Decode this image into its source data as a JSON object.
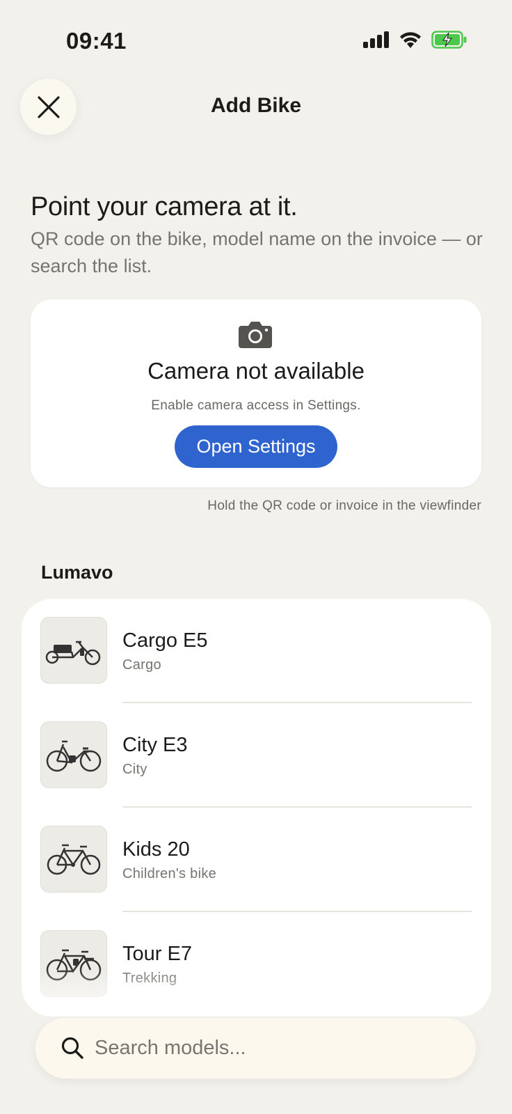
{
  "status_bar": {
    "time": "09:41",
    "icons": [
      "signal-icon",
      "wifi-icon",
      "battery-charging-icon"
    ],
    "battery_color": "#4cc94c"
  },
  "nav": {
    "close_icon": "close-icon",
    "title": "Add Bike"
  },
  "intro": {
    "headline": "Point your camera at it.",
    "subtext": "QR code on the bike, model name on the invoice — or search the list."
  },
  "camera": {
    "icon": "camera-icon",
    "title": "Camera not available",
    "hint": "Enable camera access in Settings.",
    "button_label": "Open Settings",
    "viewfinder_hint": "Hold the QR code or invoice in the viewfinder"
  },
  "brand": {
    "label": "Lumavo",
    "models": [
      {
        "name": "Cargo E5",
        "type": "Cargo",
        "icon": "cargo-bike-icon"
      },
      {
        "name": "City E3",
        "type": "City",
        "icon": "city-bike-icon"
      },
      {
        "name": "Kids 20",
        "type": "Children's bike",
        "icon": "kids-bike-icon"
      },
      {
        "name": "Tour E7",
        "type": "Trekking",
        "icon": "trekking-bike-icon"
      }
    ]
  },
  "search": {
    "icon": "search-icon",
    "placeholder": "Search models..."
  },
  "colors": {
    "background": "#f2f1ec",
    "accent": "#2f64cf",
    "card": "#ffffff"
  }
}
